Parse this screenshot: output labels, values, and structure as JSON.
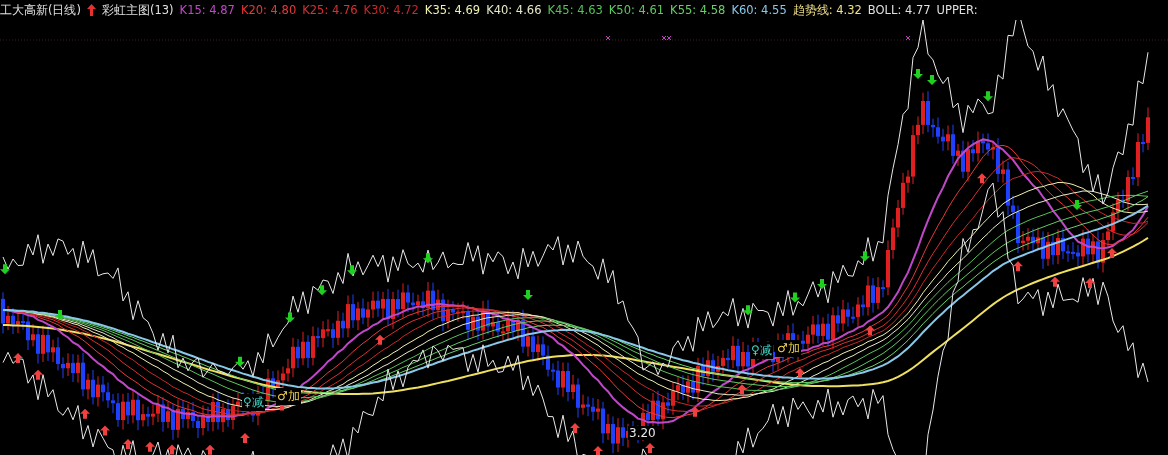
{
  "header": {
    "security": "工大高新(日线)",
    "indicator": "彩虹主图(13)"
  },
  "legend": [
    {
      "text": "K15: 4.87",
      "color": "#c048c8"
    },
    {
      "text": "K20: 4.80",
      "color": "#e83838"
    },
    {
      "text": "K25: 4.76",
      "color": "#d83030"
    },
    {
      "text": "K30: 4.72",
      "color": "#c82828"
    },
    {
      "text": "K35: 4.69",
      "color": "#f0f0b0"
    },
    {
      "text": "K40: 4.66",
      "color": "#e8e8c8"
    },
    {
      "text": "K45: 4.63",
      "color": "#58c058"
    },
    {
      "text": "K50: 4.61",
      "color": "#60c860"
    },
    {
      "text": "K55: 4.58",
      "color": "#68d068"
    },
    {
      "text": "K60: 4.55",
      "color": "#88c8e8"
    },
    {
      "text": "趋势线: 4.32",
      "color": "#f0e088"
    },
    {
      "text": "BOLL: 4.77",
      "color": "#e0e0e0"
    },
    {
      "text": "UPPER:",
      "color": "#e0e0e0"
    }
  ],
  "annotations": [
    {
      "text": "3.20",
      "kind": "price"
    },
    {
      "text": "♀减",
      "kind": "sell"
    },
    {
      "text": "♂加",
      "kind": "buy"
    },
    {
      "text": "♀减",
      "kind": "sell"
    },
    {
      "text": "♂加",
      "kind": "buy"
    }
  ]
}
